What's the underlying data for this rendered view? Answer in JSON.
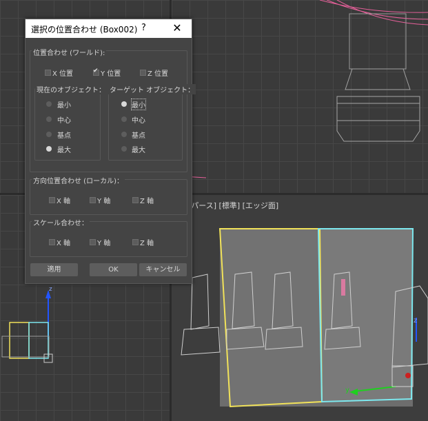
{
  "viewport_perspective": {
    "label": "[パース] [標準] [エッジ面]"
  },
  "axes": {
    "z": "z",
    "y": "y"
  },
  "dialog": {
    "title": "選択の位置合わせ (Box002)",
    "help_glyph": "?",
    "close_glyph": "✕",
    "world_group": {
      "label": "位置合わせ (ワールド):",
      "x": {
        "label": "X 位置",
        "checked": false
      },
      "y": {
        "label": "Y 位置",
        "checked": true
      },
      "z": {
        "label": "Z 位置",
        "checked": false
      }
    },
    "current_object": {
      "label": "現在のオブジェクト：",
      "options": [
        "最小",
        "中心",
        "基点",
        "最大"
      ],
      "selected": "最大"
    },
    "target_object": {
      "label": "ターゲット オブジェクト：",
      "options": [
        "最小",
        "中心",
        "基点",
        "最大"
      ],
      "selected": "最小"
    },
    "orientation_group": {
      "label": "方向位置合わせ (ローカル)：",
      "x": "X 軸",
      "y": "Y 軸",
      "z": "Z 軸"
    },
    "scale_group": {
      "label": "スケール合わせ：",
      "x": "X 軸",
      "y": "Y 軸",
      "z": "Z 軸"
    },
    "buttons": {
      "apply": "適用",
      "ok": "OK",
      "cancel": "キャンセル"
    }
  }
}
